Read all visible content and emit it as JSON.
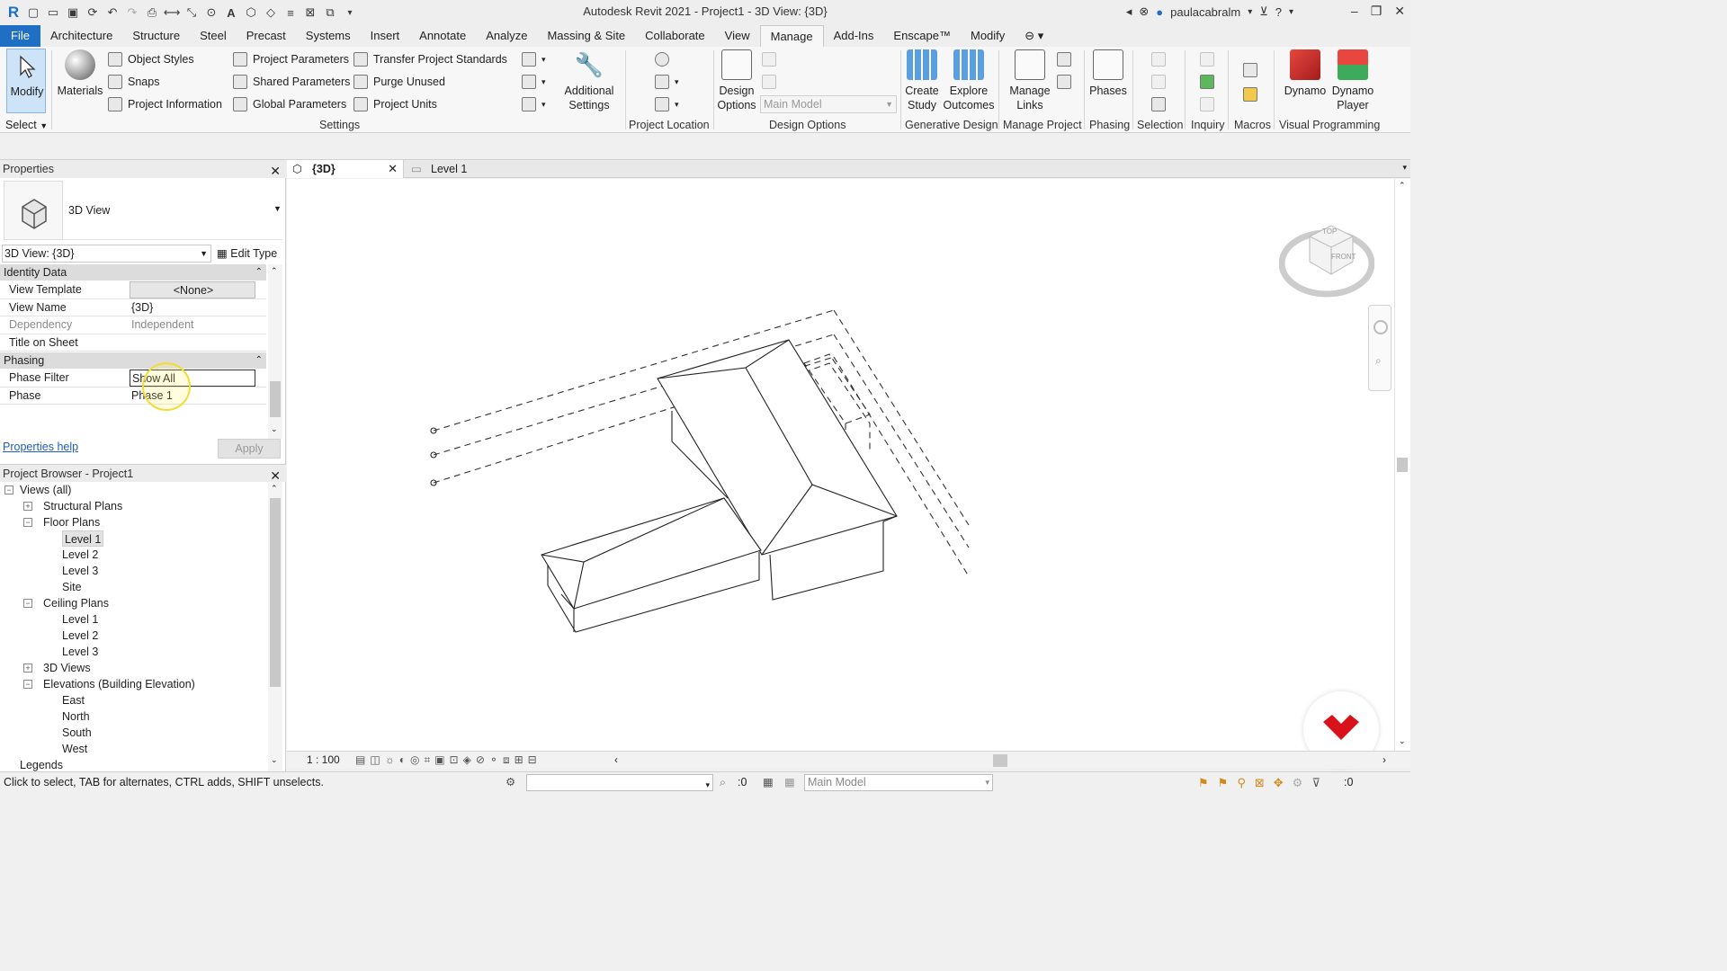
{
  "window": {
    "title": "Autodesk Revit 2021 - Project1 - 3D View: {3D}",
    "user": "paulacabralm"
  },
  "ribbon_tabs": [
    "File",
    "Architecture",
    "Structure",
    "Steel",
    "Precast",
    "Systems",
    "Insert",
    "Annotate",
    "Analyze",
    "Massing & Site",
    "Collaborate",
    "View",
    "Manage",
    "Add-Ins",
    "Enscape™",
    "Modify"
  ],
  "active_tab": "Manage",
  "ribbon": {
    "modify": "Modify",
    "select": "Select",
    "materials": "Materials",
    "object_styles": "Object Styles",
    "snaps": "Snaps",
    "project_information": "Project Information",
    "project_parameters": "Project Parameters",
    "shared_parameters": "Shared Parameters",
    "global_parameters": "Global Parameters",
    "transfer_project_standards": "Transfer Project Standards",
    "purge_unused": "Purge Unused",
    "project_units": "Project Units",
    "settings_label": "Settings",
    "additional_settings_1": "Additional",
    "additional_settings_2": "Settings",
    "project_location_label": "Project Location",
    "design_options_1": "Design",
    "design_options_2": "Options",
    "main_model": "Main Model",
    "design_options_label": "Design Options",
    "create_study_1": "Create",
    "create_study_2": "Study",
    "explore_outcomes_1": "Explore",
    "explore_outcomes_2": "Outcomes",
    "generative_design_label": "Generative Design",
    "manage_links_1": "Manage",
    "manage_links_2": "Links",
    "manage_project_label": "Manage Project",
    "phases": "Phases",
    "phasing_label": "Phasing",
    "selection_label": "Selection",
    "inquiry_label": "Inquiry",
    "macros_label": "Macros",
    "dynamo": "Dynamo",
    "dynamo_player_1": "Dynamo",
    "dynamo_player_2": "Player",
    "visual_programming_label": "Visual Programming"
  },
  "properties": {
    "title": "Properties",
    "type_name": "3D View",
    "instance_selector": "3D View: {3D}",
    "edit_type": "Edit Type",
    "identity_group": "Identity Data",
    "rows_identity": [
      {
        "k": "View Template",
        "v": "<None>"
      },
      {
        "k": "View Name",
        "v": "{3D}"
      },
      {
        "k": "Dependency",
        "v": "Independent"
      },
      {
        "k": "Title on Sheet",
        "v": ""
      }
    ],
    "phasing_group": "Phasing",
    "rows_phasing": [
      {
        "k": "Phase Filter",
        "v": "Show All"
      },
      {
        "k": "Phase",
        "v": "Phase 1"
      }
    ],
    "help_link": "Properties help",
    "apply": "Apply"
  },
  "browser": {
    "title": "Project Browser - Project1",
    "items": [
      {
        "label": "Views (all)",
        "level": 0,
        "expander": "-"
      },
      {
        "label": "Structural Plans",
        "level": 1,
        "expander": "+"
      },
      {
        "label": "Floor Plans",
        "level": 1,
        "expander": "-"
      },
      {
        "label": "Level 1",
        "level": 2,
        "selected": true
      },
      {
        "label": "Level 2",
        "level": 2
      },
      {
        "label": "Level 3",
        "level": 2
      },
      {
        "label": "Site",
        "level": 2
      },
      {
        "label": "Ceiling Plans",
        "level": 1,
        "expander": "-"
      },
      {
        "label": "Level 1",
        "level": 2
      },
      {
        "label": "Level 2",
        "level": 2
      },
      {
        "label": "Level 3",
        "level": 2
      },
      {
        "label": "3D Views",
        "level": 1,
        "expander": "+"
      },
      {
        "label": "Elevations (Building Elevation)",
        "level": 1,
        "expander": "-"
      },
      {
        "label": "East",
        "level": 2
      },
      {
        "label": "North",
        "level": 2
      },
      {
        "label": "South",
        "level": 2
      },
      {
        "label": "West",
        "level": 2
      },
      {
        "label": "Legends",
        "level": 0
      }
    ]
  },
  "view_tabs": [
    {
      "label": "{3D}",
      "active": true
    },
    {
      "label": "Level 1",
      "active": false
    }
  ],
  "viewcube": {
    "top": "TOP",
    "front": "FRONT"
  },
  "view_scale": "1 : 100",
  "status": {
    "hint": "Click to select, TAB for alternates, CTRL adds, SHIFT unselects.",
    "count": ":0",
    "model": "Main Model",
    "filter_count": ":0"
  },
  "colors": {
    "file_tab": "#1f6fc5",
    "brand": "#d9111b"
  }
}
